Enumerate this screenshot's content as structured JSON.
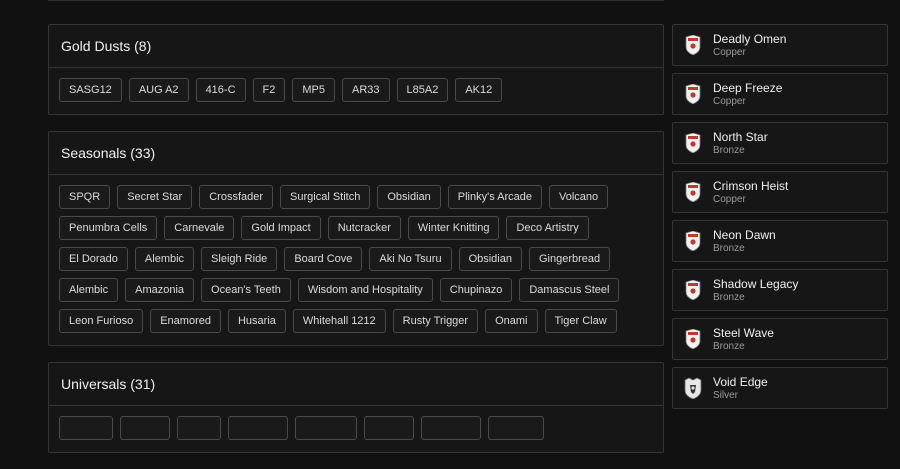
{
  "sections": [
    {
      "title": "Gold Dusts (8)",
      "chips": [
        "SASG12",
        "AUG A2",
        "416-C",
        "F2",
        "MP5",
        "AR33",
        "L85A2",
        "AK12"
      ]
    },
    {
      "title": "Seasonals (33)",
      "chips": [
        "SPQR",
        "Secret Star",
        "Crossfader",
        "Surgical Stitch",
        "Obsidian",
        "Plinky's Arcade",
        "Volcano",
        "Penumbra Cells",
        "Carnevale",
        "Gold Impact",
        "Nutcracker",
        "Winter Knitting",
        "Deco Artistry",
        "El Dorado",
        "Alembic",
        "Sleigh Ride",
        "Board Cove",
        "Aki No Tsuru",
        "Obsidian",
        "Gingerbread",
        "Alembic",
        "Amazonia",
        "Ocean's Teeth",
        "Wisdom and Hospitality",
        "Chupinazo",
        "Damascus Steel",
        "Leon Furioso",
        "Enamored",
        "Husaria",
        "Whitehall 1212",
        "Rusty Trigger",
        "Onami",
        "Tiger Claw"
      ]
    },
    {
      "title": "Universals (31)",
      "chips": []
    }
  ],
  "cards": [
    {
      "name": "Deadly Omen",
      "tier": "Copper",
      "icon": "shield-icon"
    },
    {
      "name": "Deep Freeze",
      "tier": "Copper",
      "icon": "shield-icon"
    },
    {
      "name": "North Star",
      "tier": "Bronze",
      "icon": "shield-icon"
    },
    {
      "name": "Crimson Heist",
      "tier": "Copper",
      "icon": "shield-icon"
    },
    {
      "name": "Neon Dawn",
      "tier": "Bronze",
      "icon": "shield-icon"
    },
    {
      "name": "Shadow Legacy",
      "tier": "Bronze",
      "icon": "shield-icon"
    },
    {
      "name": "Steel Wave",
      "tier": "Bronze",
      "icon": "shield-icon"
    },
    {
      "name": "Void Edge",
      "tier": "Silver",
      "icon": "silver-shield-icon"
    }
  ],
  "colors": {
    "background": "#111111",
    "panel": "#161616",
    "border": "#343434",
    "shield_red": "#c0392b"
  }
}
